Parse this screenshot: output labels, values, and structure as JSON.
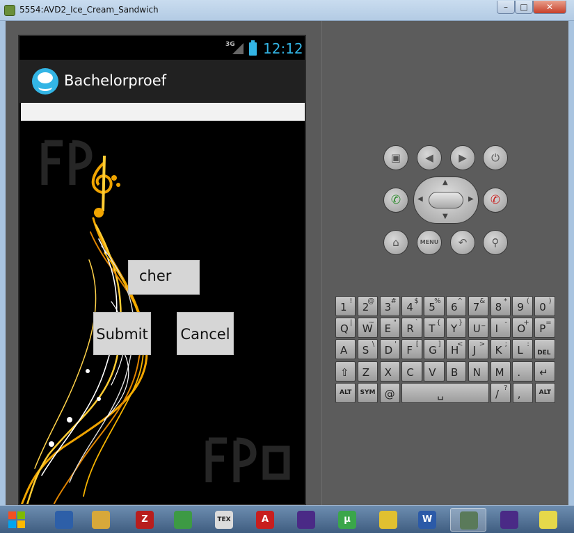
{
  "window": {
    "title": "5554:AVD2_Ice_Cream_Sandwich",
    "min_label": "–",
    "max_label": "□",
    "close_label": "✕"
  },
  "statusbar": {
    "network": "3G",
    "clock": "12:12"
  },
  "actionbar": {
    "title": "Bachelorproef"
  },
  "form": {
    "input_value": "cher",
    "submit_label": "Submit",
    "cancel_label": "Cancel"
  },
  "hardware_buttons": {
    "camera": "camera-icon",
    "volume_down": "volume-down-icon",
    "volume_up": "volume-up-icon",
    "power": "power-icon",
    "call": "call-icon",
    "end_call": "end-call-icon",
    "home": "home-icon",
    "menu_label": "MENU",
    "back": "back-icon",
    "search": "search-icon"
  },
  "keyboard": {
    "row1": [
      {
        "main": "1",
        "alt": "!"
      },
      {
        "main": "2",
        "alt": "@"
      },
      {
        "main": "3",
        "alt": "#"
      },
      {
        "main": "4",
        "alt": "$"
      },
      {
        "main": "5",
        "alt": "%"
      },
      {
        "main": "6",
        "alt": "^"
      },
      {
        "main": "7",
        "alt": "&"
      },
      {
        "main": "8",
        "alt": "*"
      },
      {
        "main": "9",
        "alt": "("
      },
      {
        "main": "0",
        "alt": ")"
      }
    ],
    "row2": [
      {
        "main": "Q",
        "alt": "|"
      },
      {
        "main": "W",
        "alt": "~"
      },
      {
        "main": "E",
        "alt": "\""
      },
      {
        "main": "R",
        "alt": "`"
      },
      {
        "main": "T",
        "alt": "{"
      },
      {
        "main": "Y",
        "alt": "}"
      },
      {
        "main": "U",
        "alt": "_"
      },
      {
        "main": "I",
        "alt": "-"
      },
      {
        "main": "O",
        "alt": "+"
      },
      {
        "main": "P",
        "alt": "="
      }
    ],
    "row3": [
      {
        "main": "A",
        "alt": ""
      },
      {
        "main": "S",
        "alt": "\\"
      },
      {
        "main": "D",
        "alt": "'"
      },
      {
        "main": "F",
        "alt": "["
      },
      {
        "main": "G",
        "alt": "]"
      },
      {
        "main": "H",
        "alt": "<"
      },
      {
        "main": "J",
        "alt": ">"
      },
      {
        "main": "K",
        "alt": ";"
      },
      {
        "main": "L",
        "alt": ":"
      },
      {
        "main": "DEL",
        "alt": ""
      }
    ],
    "row4": [
      {
        "main": "⇧",
        "alt": ""
      },
      {
        "main": "Z",
        "alt": ""
      },
      {
        "main": "X",
        "alt": ""
      },
      {
        "main": "C",
        "alt": ""
      },
      {
        "main": "V",
        "alt": ""
      },
      {
        "main": "B",
        "alt": ""
      },
      {
        "main": "N",
        "alt": ""
      },
      {
        "main": "M",
        "alt": ""
      },
      {
        "main": ".",
        "alt": ""
      },
      {
        "main": "↵",
        "alt": ""
      }
    ],
    "row5": {
      "alt_left": "ALT",
      "sym": "SYM",
      "at": "@",
      "space": "␣",
      "slash": "/",
      "slash_alt": "?",
      "comma": ",",
      "alt_right": "ALT"
    }
  },
  "taskbar": {
    "items": [
      {
        "name": "show-desktop-icon",
        "label": "",
        "color": "#2d5fa8"
      },
      {
        "name": "explorer-icon",
        "label": "",
        "color": "#d7a83a"
      },
      {
        "name": "filezilla-icon",
        "label": "Z",
        "color": "#b81d1d"
      },
      {
        "name": "chrome-icon",
        "label": "",
        "color": "#3d9a44"
      },
      {
        "name": "tex-icon",
        "label": "TEX",
        "color": "#dcdcdc"
      },
      {
        "name": "app-a-icon",
        "label": "A",
        "color": "#c81e1e"
      },
      {
        "name": "eclipse-icon",
        "label": "",
        "color": "#4a2a86"
      },
      {
        "name": "utorrent-icon",
        "label": "µ",
        "color": "#3aa64a"
      },
      {
        "name": "tool-icon",
        "label": "",
        "color": "#e0c030"
      },
      {
        "name": "word-icon",
        "label": "W",
        "color": "#2b5aa8"
      },
      {
        "name": "emulator-icon",
        "label": "",
        "color": "#5a7a5a"
      },
      {
        "name": "eclipse-2-icon",
        "label": "",
        "color": "#4a2a86"
      },
      {
        "name": "chart-app-icon",
        "label": "",
        "color": "#e6d84a"
      }
    ]
  }
}
